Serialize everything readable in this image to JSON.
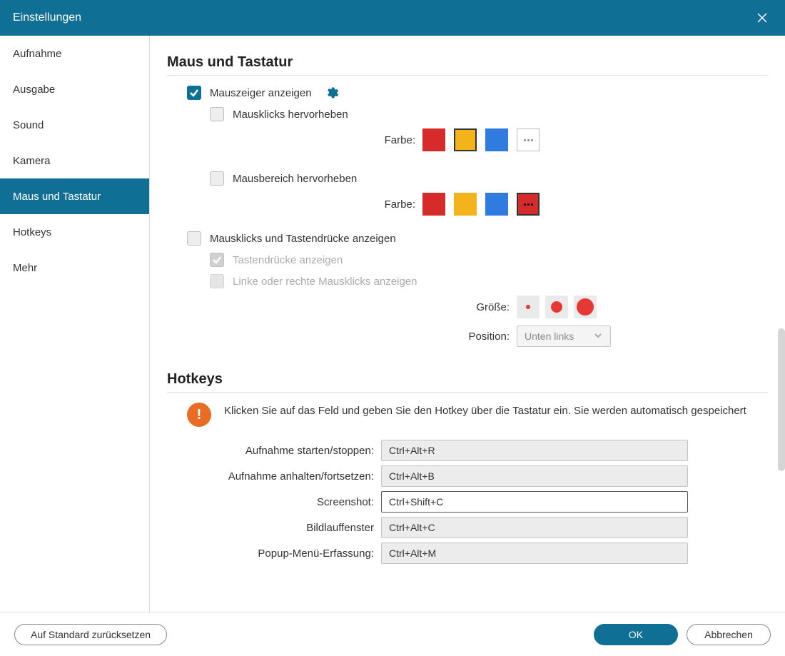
{
  "title": "Einstellungen",
  "sidebar": {
    "items": [
      {
        "label": "Aufnahme"
      },
      {
        "label": "Ausgabe"
      },
      {
        "label": "Sound"
      },
      {
        "label": "Kamera"
      },
      {
        "label": "Maus und Tastatur"
      },
      {
        "label": "Hotkeys"
      },
      {
        "label": "Mehr"
      }
    ],
    "active_index": 4
  },
  "section_mouse": {
    "title": "Maus und Tastatur",
    "show_cursor": "Mauszeiger anzeigen",
    "highlight_clicks": "Mausklicks hervorheben",
    "color_label": "Farbe:",
    "highlight_area": "Mausbereich hervorheben",
    "show_clicks_keys": "Mausklicks und Tastendrücke anzeigen",
    "show_keys": "Tastendrücke anzeigen",
    "show_lr_clicks": "Linke oder rechte Mausklicks anzeigen",
    "size_label": "Größe:",
    "position_label": "Position:",
    "position_value": "Unten links",
    "colors": {
      "red": "#d52b2b",
      "yellow": "#f3b41b",
      "blue": "#2f7be0"
    }
  },
  "section_hotkeys": {
    "title": "Hotkeys",
    "info": "Klicken Sie auf das Feld und geben Sie den Hotkey über die Tastatur ein. Sie werden automatisch gespeichert",
    "rows": [
      {
        "label": "Aufnahme starten/stoppen:",
        "value": "Ctrl+Alt+R"
      },
      {
        "label": "Aufnahme anhalten/fortsetzen:",
        "value": "Ctrl+Alt+B"
      },
      {
        "label": "Screenshot:",
        "value": "Ctrl+Shift+C"
      },
      {
        "label": "Bildlauffenster",
        "value": "Ctrl+Alt+C"
      },
      {
        "label": "Popup-Menü-Erfassung:",
        "value": "Ctrl+Alt+M"
      }
    ],
    "active_index": 2
  },
  "footer": {
    "reset": "Auf Standard zurücksetzen",
    "ok": "OK",
    "cancel": "Abbrechen"
  }
}
